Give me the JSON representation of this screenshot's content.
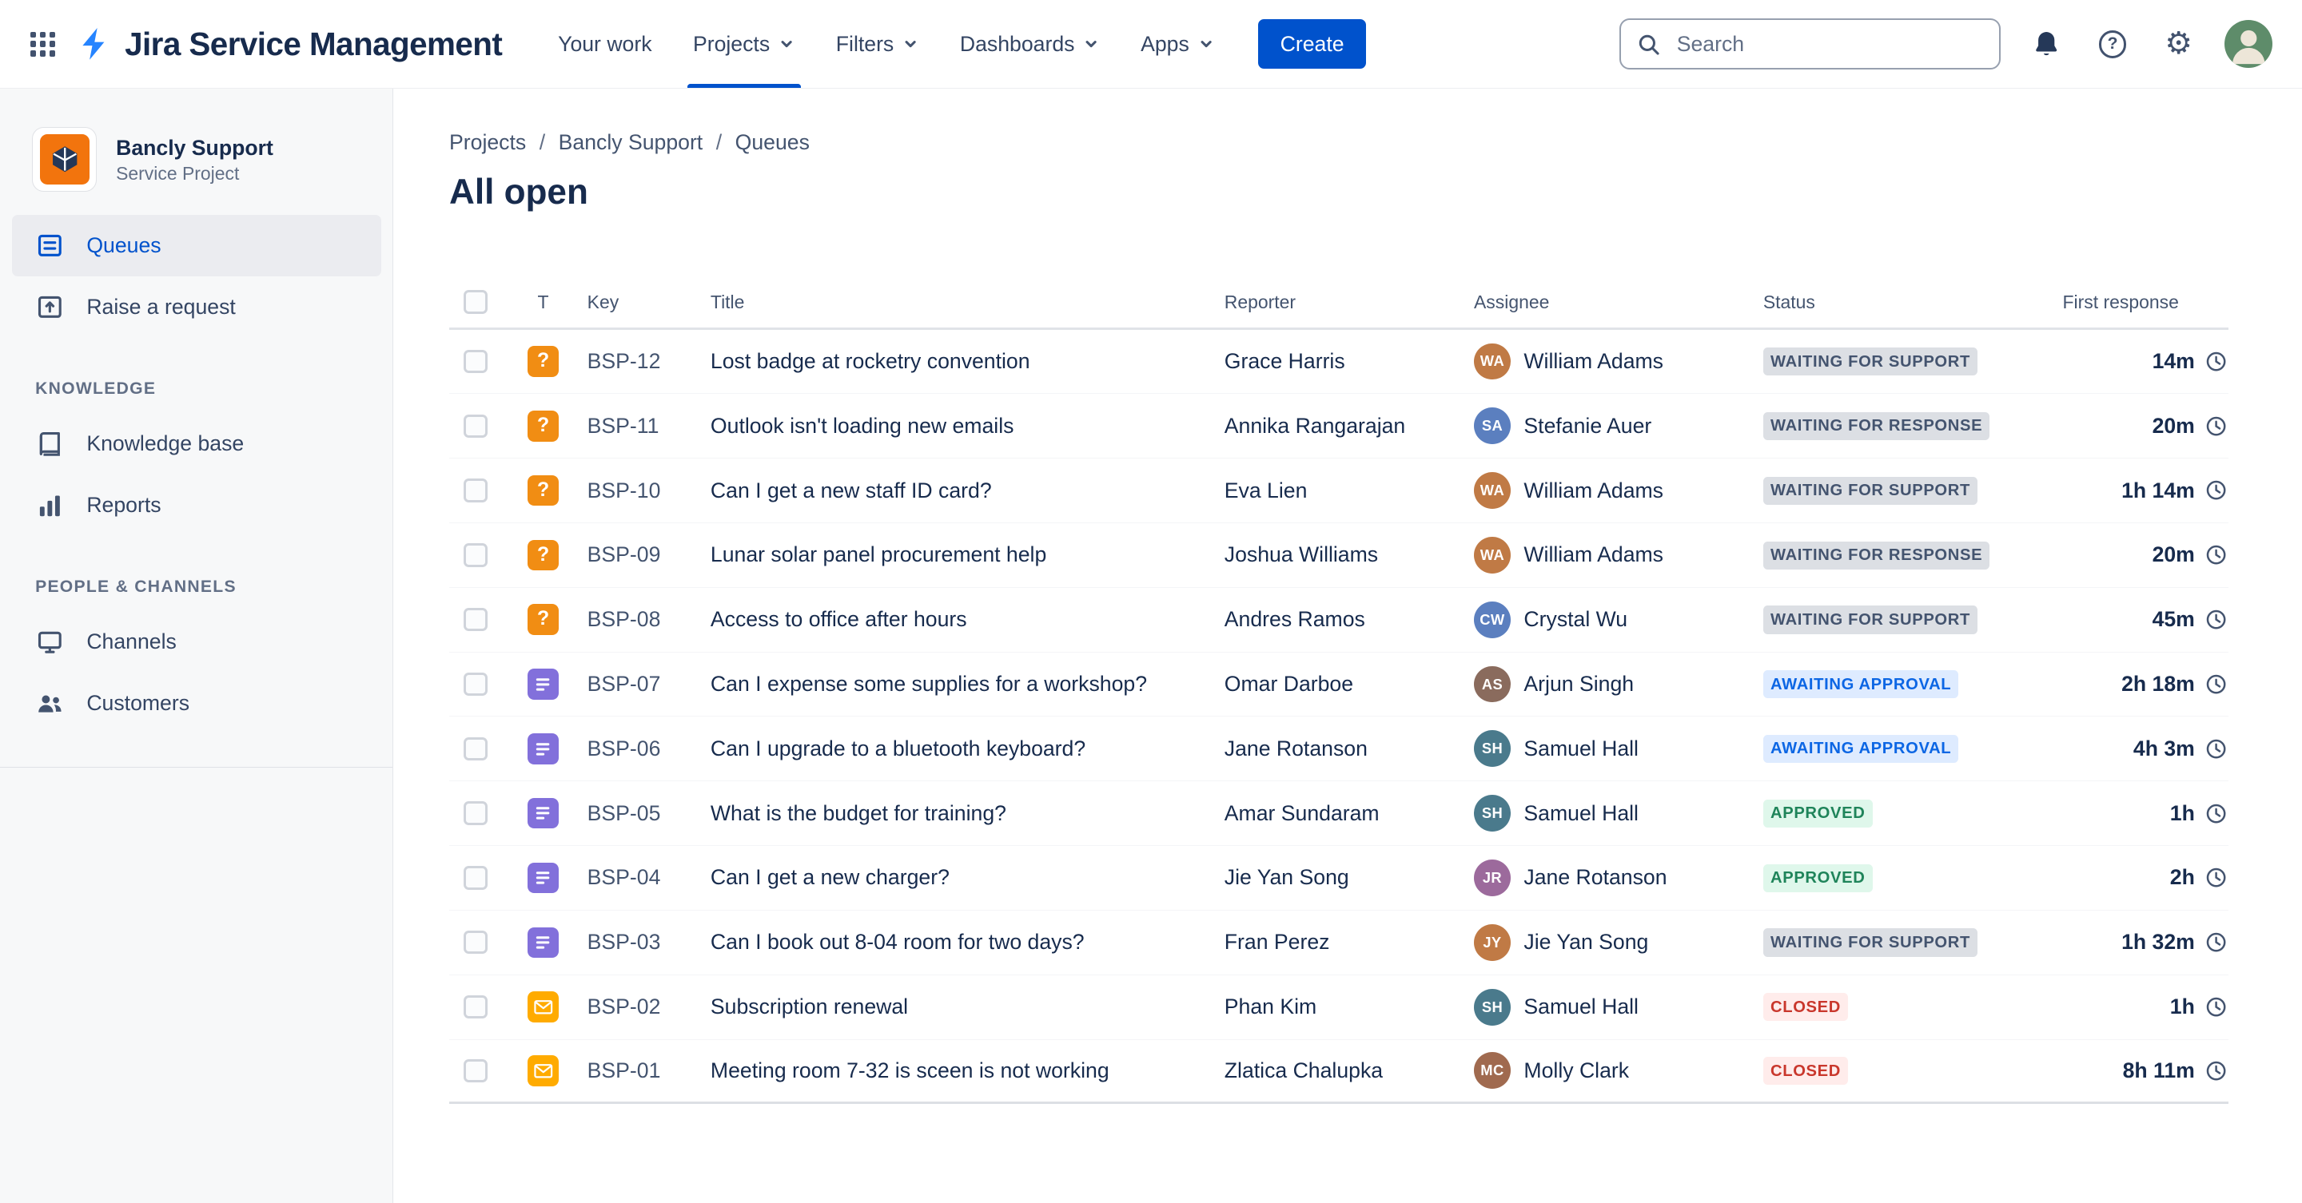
{
  "topbar": {
    "product_name": "Jira Service Management",
    "nav": [
      {
        "label": "Your work"
      },
      {
        "label": "Projects"
      },
      {
        "label": "Filters"
      },
      {
        "label": "Dashboards"
      },
      {
        "label": "Apps"
      }
    ],
    "create_label": "Create",
    "search_placeholder": "Search"
  },
  "sidebar": {
    "project": {
      "name": "Bancly Support",
      "type": "Service Project"
    },
    "items": [
      {
        "label": "Queues"
      },
      {
        "label": "Raise a request"
      }
    ],
    "sections": [
      {
        "heading": "KNOWLEDGE",
        "items": [
          {
            "label": "Knowledge base"
          },
          {
            "label": "Reports"
          }
        ]
      },
      {
        "heading": "PEOPLE & CHANNELS",
        "items": [
          {
            "label": "Channels"
          },
          {
            "label": "Customers"
          }
        ]
      }
    ]
  },
  "main": {
    "breadcrumb": [
      "Projects",
      "Bancly Support",
      "Queues"
    ],
    "title": "All open",
    "table": {
      "columns": {
        "type": "T",
        "key": "Key",
        "title": "Title",
        "reporter": "Reporter",
        "assignee": "Assignee",
        "status": "Status",
        "first_response": "First response"
      },
      "rows": [
        {
          "type": "question",
          "key": "BSP-12",
          "title": "Lost badge at rocketry convention",
          "reporter": "Grace Harris",
          "assignee": "William Adams",
          "status": "WAITING FOR SUPPORT",
          "status_kind": "gray",
          "first_response": "14m"
        },
        {
          "type": "question",
          "key": "BSP-11",
          "title": "Outlook isn't loading new emails",
          "reporter": "Annika Rangarajan",
          "assignee": "Stefanie Auer",
          "status": "WAITING FOR RESPONSE",
          "status_kind": "gray",
          "first_response": "20m"
        },
        {
          "type": "question",
          "key": "BSP-10",
          "title": "Can I get a new staff ID card?",
          "reporter": "Eva Lien",
          "assignee": "William Adams",
          "status": "WAITING FOR SUPPORT",
          "status_kind": "gray",
          "first_response": "1h 14m"
        },
        {
          "type": "question",
          "key": "BSP-09",
          "title": "Lunar solar panel procurement help",
          "reporter": "Joshua Williams",
          "assignee": "William Adams",
          "status": "WAITING FOR RESPONSE",
          "status_kind": "gray",
          "first_response": "20m"
        },
        {
          "type": "question",
          "key": "BSP-08",
          "title": "Access to office after hours",
          "reporter": "Andres Ramos",
          "assignee": "Crystal Wu",
          "status": "WAITING FOR SUPPORT",
          "status_kind": "gray",
          "first_response": "45m"
        },
        {
          "type": "request",
          "key": "BSP-07",
          "title": "Can I expense some supplies for a workshop?",
          "reporter": "Omar Darboe",
          "assignee": "Arjun Singh",
          "status": "AWAITING APPROVAL",
          "status_kind": "blue",
          "first_response": "2h 18m"
        },
        {
          "type": "request",
          "key": "BSP-06",
          "title": "Can I upgrade to a bluetooth keyboard?",
          "reporter": "Jane Rotanson",
          "assignee": "Samuel Hall",
          "status": "AWAITING APPROVAL",
          "status_kind": "blue",
          "first_response": "4h 3m"
        },
        {
          "type": "request",
          "key": "BSP-05",
          "title": "What is the budget for training?",
          "reporter": "Amar Sundaram",
          "assignee": "Samuel Hall",
          "status": "APPROVED",
          "status_kind": "green",
          "first_response": "1h"
        },
        {
          "type": "request",
          "key": "BSP-04",
          "title": "Can I get a new charger?",
          "reporter": "Jie Yan Song",
          "assignee": "Jane Rotanson",
          "status": "APPROVED",
          "status_kind": "green",
          "first_response": "2h"
        },
        {
          "type": "request",
          "key": "BSP-03",
          "title": "Can I book out 8-04 room for two days?",
          "reporter": "Fran Perez",
          "assignee": "Jie Yan Song",
          "status": "WAITING FOR SUPPORT",
          "status_kind": "gray",
          "first_response": "1h 32m"
        },
        {
          "type": "email",
          "key": "BSP-02",
          "title": "Subscription renewal",
          "reporter": "Phan Kim",
          "assignee": "Samuel Hall",
          "status": "CLOSED",
          "status_kind": "red",
          "first_response": "1h"
        },
        {
          "type": "email",
          "key": "BSP-01",
          "title": "Meeting room 7-32 is sceen is not working",
          "reporter": "Zlatica Chalupka",
          "assignee": "Molly Clark",
          "status": "CLOSED",
          "status_kind": "red",
          "first_response": "8h 11m"
        }
      ]
    }
  },
  "type_styles": {
    "question": {
      "bg": "#F18D13"
    },
    "request": {
      "bg": "#8270DB"
    },
    "email": {
      "bg": "#FFAB00"
    }
  },
  "status_styles": {
    "gray": {
      "bg": "#DCDFE4",
      "fg": "#44546F"
    },
    "blue": {
      "bg": "#DEEBFF",
      "fg": "#0C66E4"
    },
    "green": {
      "bg": "#DFF7EB",
      "fg": "#1F845A"
    },
    "red": {
      "bg": "#FFECEB",
      "fg": "#C9372C"
    }
  },
  "colors": {
    "accent": "#0052CC",
    "title_text": "#172B4D",
    "muted_text": "#44546F",
    "sidebar_bg": "#F7F8F9"
  }
}
